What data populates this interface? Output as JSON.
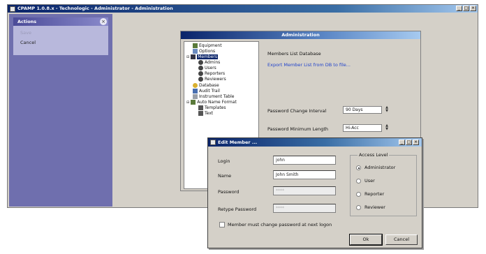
{
  "main_window": {
    "title": "CPAMP 1.0.8.x - Technologic - Administrator - Administration",
    "caption_buttons": {
      "minimize": "_",
      "maximize": "□",
      "close": "×"
    }
  },
  "left_panel": {
    "header": "Actions",
    "close_glyph": "×",
    "items": [
      "Save",
      "Cancel"
    ]
  },
  "admin_window": {
    "title": "Administration",
    "tree": [
      {
        "label": "Equipment",
        "icon": "equipment-icon"
      },
      {
        "label": "Options",
        "icon": "options-icon"
      },
      {
        "label": "Members",
        "icon": "members-icon",
        "selected": true
      },
      {
        "label": "Admins",
        "icon": "person-icon"
      },
      {
        "label": "Users",
        "icon": "person-icon"
      },
      {
        "label": "Reporters",
        "icon": "person-icon"
      },
      {
        "label": "Reviewers",
        "icon": "person-icon"
      },
      {
        "label": "Database",
        "icon": "database-icon"
      },
      {
        "label": "Audit Trail",
        "icon": "audit-icon"
      },
      {
        "label": "Instrument Table",
        "icon": "table-icon"
      },
      {
        "label": "Auto Name Format",
        "icon": "format-icon"
      },
      {
        "label": "Templates",
        "icon": "template-icon"
      },
      {
        "label": "Text",
        "icon": "template-icon"
      }
    ],
    "section_title": "Members List Database",
    "link": "Export Member List from DB to file...",
    "password_change_interval": {
      "label": "Password Change Interval",
      "value": "90 Days"
    },
    "password_minimum_length": {
      "label": "Password Minimum Length",
      "value": "Hi-Acc"
    }
  },
  "edit_member": {
    "title": "Edit Member ...",
    "caption_buttons": {
      "minimize": "_",
      "maximize": "□",
      "close": "×"
    },
    "fields": {
      "login": {
        "label": "Login",
        "value": "john"
      },
      "name": {
        "label": "Name",
        "value": "John Smith"
      },
      "password": {
        "label": "Password",
        "value": "****"
      },
      "retype_password": {
        "label": "Retype Password",
        "value": "****"
      }
    },
    "access_level": {
      "legend": "Access Level",
      "options": [
        "Administrator",
        "User",
        "Reporter",
        "Reviewer"
      ],
      "selected": "Administrator"
    },
    "must_change_password": "Member must change password at next logon",
    "ok_label": "Ok",
    "cancel_label": "Cancel"
  }
}
